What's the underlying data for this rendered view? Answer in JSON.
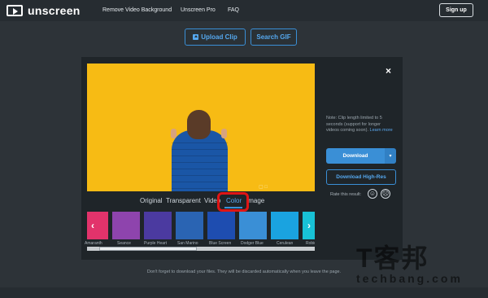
{
  "nav": {
    "logo_text": "unscreen",
    "links": [
      "Remove Video Background",
      "Unscreen Pro",
      "FAQ"
    ],
    "signup_label": "Sign up"
  },
  "actions": {
    "upload_label": "Upload Clip",
    "search_label": "Search GIF"
  },
  "modal": {
    "close_label": "×",
    "preview_watermark": "▢ □",
    "tabs": [
      "Original",
      "Transparent",
      "Video",
      "Color",
      "Image"
    ],
    "active_tab": "Color",
    "swatches": [
      {
        "name": "Amaranth",
        "color": "#e2336b"
      },
      {
        "name": "Seance",
        "color": "#8e44ad"
      },
      {
        "name": "Purple Heart",
        "color": "#4b3aa0"
      },
      {
        "name": "San Marino",
        "color": "#2a64b3"
      },
      {
        "name": "Blue Screen",
        "color": "#1e4db0"
      },
      {
        "name": "Dodger Blue",
        "color": "#3a8fd6"
      },
      {
        "name": "Cerulean",
        "color": "#1aa3e0"
      },
      {
        "name": "Robin's Egg",
        "color": "#18c2d6"
      }
    ],
    "note_text": "Note: Clip length limited to 5 seconds (support for longer videos coming soon).",
    "note_link": "Learn more",
    "download_label": "Download",
    "download_caret": "▾",
    "download_hr_label": "Download High-Res",
    "rate_label": "Rate this result:",
    "face_happy": "☺",
    "face_sad": "☹"
  },
  "footer": {
    "note": "Don't forget to download your files. They will be discarded automatically when you leave the page."
  },
  "watermark": {
    "cn": "T客邦",
    "en": "techbang.com"
  },
  "colors": {
    "accent": "#3a8fd6",
    "preview_bg": "#f7bb14",
    "highlight": "#e01515"
  }
}
